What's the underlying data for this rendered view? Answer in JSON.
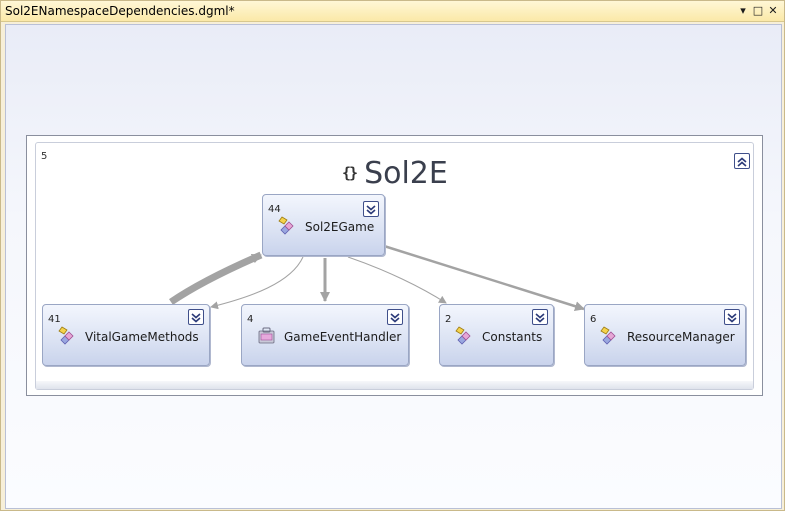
{
  "window": {
    "title": "Sol2ENamespaceDependencies.dgml*",
    "buttons": {
      "dropdown": "▾",
      "maximize": "□",
      "close": "✕"
    }
  },
  "group": {
    "name": "Sol2E",
    "count": "5",
    "icon": "namespace-braces-icon",
    "braces_glyph": "{}"
  },
  "nodes": {
    "sol2egame": {
      "label": "Sol2EGame",
      "count": "44",
      "icon": "class-icon"
    },
    "vitalgamemethods": {
      "label": "VitalGameMethods",
      "count": "41",
      "icon": "class-icon"
    },
    "gameeventhandler": {
      "label": "GameEventHandler",
      "count": "4",
      "icon": "module-icon"
    },
    "constants": {
      "label": "Constants",
      "count": "2",
      "icon": "class-icon"
    },
    "resourcemanager": {
      "label": "ResourceManager",
      "count": "6",
      "icon": "class-icon"
    }
  },
  "colors": {
    "edge": "#a3a3a3",
    "node_border": "#9aa6c4",
    "collapse_button": "#3f4f8a"
  }
}
